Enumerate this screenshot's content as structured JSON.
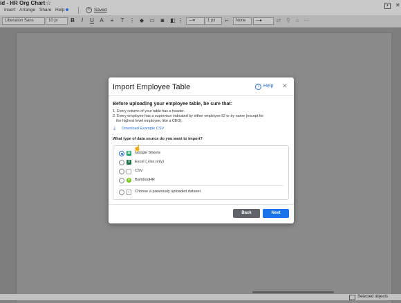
{
  "app": {
    "doc_title": "id - HR Org Chart",
    "menu": [
      "Insert",
      "Arrange",
      "Share",
      "Help"
    ],
    "saved_label": "Saved"
  },
  "toolbar": {
    "font_family": "Liberation Sans",
    "font_size": "10 pt",
    "line_width": "1 px",
    "arrow_start": "None"
  },
  "status": {
    "selected": "Selected objects"
  },
  "modal": {
    "title": "Import Employee Table",
    "help_label": "Help",
    "close_glyph": "✕",
    "subtitle": "Before uploading your employee table, be sure that:",
    "rules": [
      "1. Every column of your table has a header.",
      "2. Every employee has a supervisor indicated by either employee ID or by name (except for",
      "the highest level employee, like a CEO)."
    ],
    "download_label": "Download Example CSV",
    "question": "What type of data source do you want to import?",
    "options": [
      {
        "label": "Google Sheets",
        "selected": true,
        "icon": "google-sheets-icon",
        "color": "#0f9d58"
      },
      {
        "label": "Excel (.xlsx only)",
        "selected": false,
        "icon": "excel-icon",
        "color": "#1e7145"
      },
      {
        "label": "CSV",
        "selected": false,
        "icon": "csv-file-icon",
        "color": "#9e9e9e"
      },
      {
        "label": "BambooHR",
        "selected": false,
        "icon": "bamboohr-icon",
        "color": "#73c41d"
      },
      {
        "label": "Choose a previously uploaded dataset",
        "selected": false,
        "icon": "dataset-icon",
        "color": "#9e9e9e"
      }
    ],
    "back_label": "Back",
    "next_label": "Next"
  },
  "colors": {
    "accent": "#1a73e8",
    "back_button": "#5f6368"
  }
}
